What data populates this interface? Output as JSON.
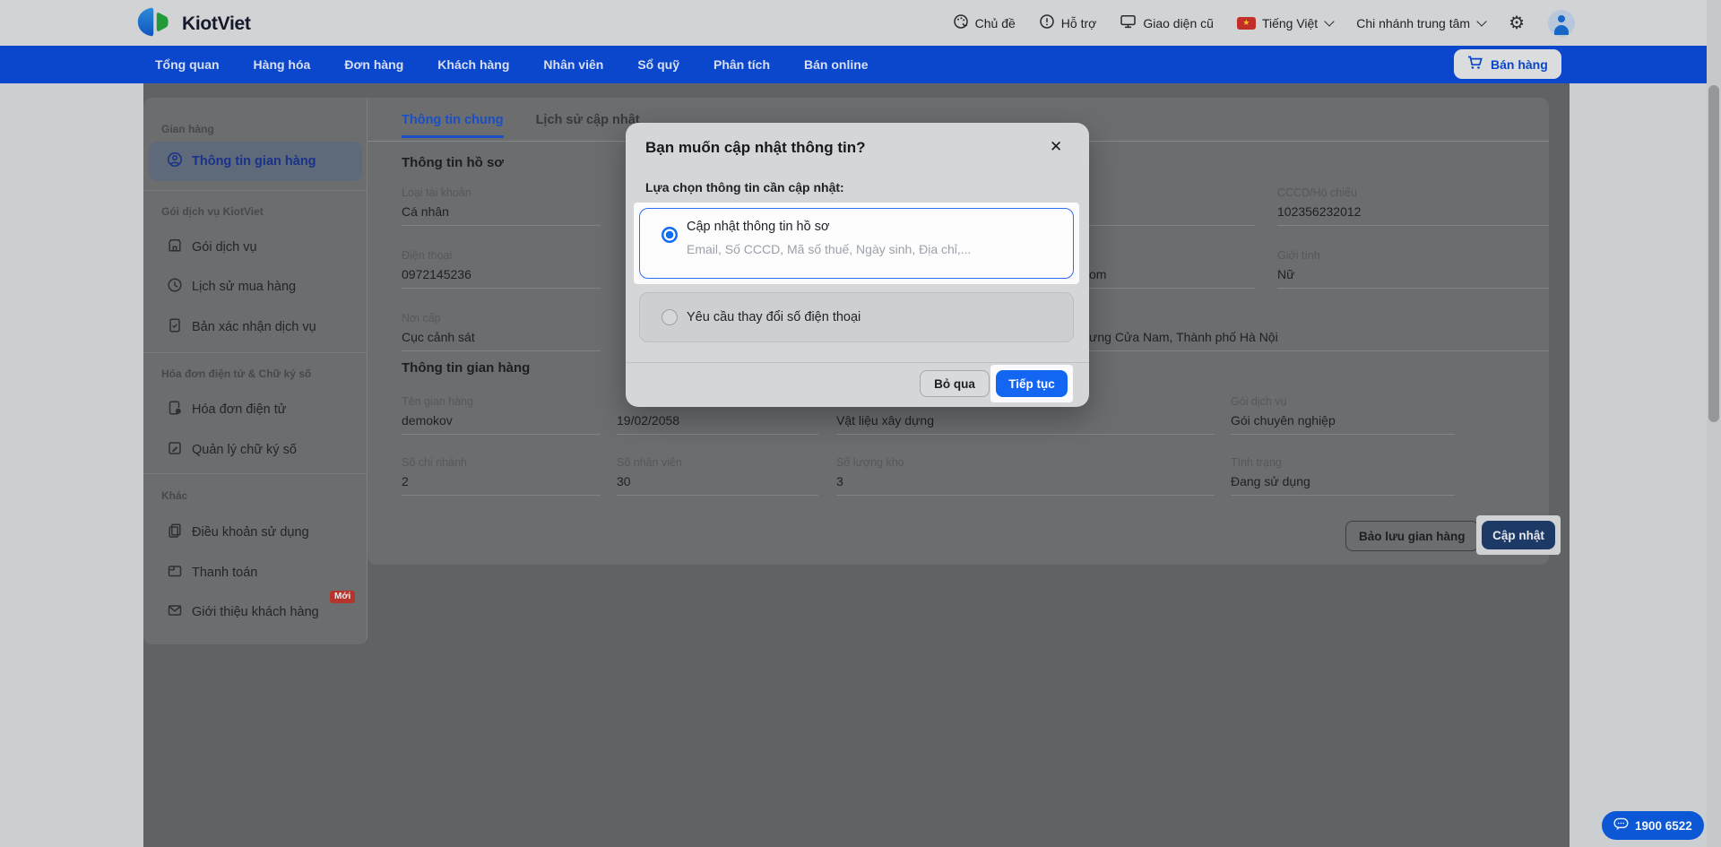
{
  "header": {
    "brand": "KiotViet",
    "menu": [
      {
        "icon": "palette-icon",
        "label": "Chủ đề"
      },
      {
        "icon": "help-icon",
        "label": "Hỗ trợ"
      },
      {
        "icon": "monitor-icon",
        "label": "Giao diện cũ"
      }
    ],
    "language": {
      "icon": "vietnam-flag-icon",
      "star": "★",
      "label": "Tiếng Việt"
    },
    "branch": {
      "label": "Chi nhánh trung tâm"
    },
    "gear": "⚙"
  },
  "nav": {
    "items": [
      "Tổng quan",
      "Hàng hóa",
      "Đơn hàng",
      "Khách hàng",
      "Nhân viên",
      "Sổ quỹ",
      "Phân tích",
      "Bán online"
    ],
    "sell_button": "Bán hàng"
  },
  "sidebar": {
    "sections": [
      {
        "title": "Gian hàng",
        "items": [
          {
            "icon": "user-circle-icon",
            "label": "Thông tin gian hàng",
            "active": true
          }
        ]
      },
      {
        "title": "Gói dịch vụ KiotViet",
        "items": [
          {
            "icon": "store-icon",
            "label": "Gói dịch vụ"
          },
          {
            "icon": "history-icon",
            "label": "Lịch sử mua hàng"
          },
          {
            "icon": "document-check-icon",
            "label": "Bản xác nhận dịch vụ"
          }
        ]
      },
      {
        "title": "Hóa đơn điện tử & Chữ ký số",
        "items": [
          {
            "icon": "invoice-icon",
            "label": "Hóa đơn điện tử"
          },
          {
            "icon": "signature-icon",
            "label": "Quản lý chữ ký số"
          }
        ]
      },
      {
        "title": "Khác",
        "items": [
          {
            "icon": "terms-icon",
            "label": "Điều khoản sử dụng"
          },
          {
            "icon": "wallet-icon",
            "label": "Thanh toán"
          },
          {
            "icon": "mail-icon",
            "label": "Giới thiệu khách hàng",
            "badge": "Mới"
          }
        ]
      }
    ]
  },
  "main": {
    "tabs": [
      {
        "label": "Thông tin chung",
        "active": true
      },
      {
        "label": "Lịch sử cập nhật",
        "active": false
      }
    ],
    "profile": {
      "title": "Thông tin hồ sơ",
      "fields": [
        {
          "label": "Loại tài khoản",
          "value": "Cá nhân"
        },
        {
          "label": "CCCD/Hộ chiếu",
          "value": "102356232012"
        },
        {
          "label": "Điện thoại",
          "value": "0972145236"
        },
        {
          "label": "",
          "value": "om"
        },
        {
          "label": "Giới tính",
          "value": "Nữ"
        },
        {
          "label": "Nơi cấp",
          "value": "Cục cảnh sát"
        },
        {
          "label": "",
          "value": "ưng Cửa Nam, Thành phố Hà Nội"
        },
        {
          "label": "",
          "value": ""
        }
      ]
    },
    "store": {
      "title": "Thông tin gian hàng",
      "fields": [
        {
          "label": "Tên gian hàng",
          "value": "demokov"
        },
        {
          "label": "",
          "value": "19/02/2058"
        },
        {
          "label": "",
          "value": "Vật liệu xây dựng"
        },
        {
          "label": "Gói dịch vụ",
          "value": "Gói chuyên nghiệp"
        },
        {
          "label": "Số chi nhánh",
          "value": "2"
        },
        {
          "label": "Số nhân viên",
          "value": "30"
        },
        {
          "label": "Số lượng kho",
          "value": "3"
        },
        {
          "label": "Tình trạng",
          "value": "Đang sử dụng"
        }
      ]
    },
    "actions": {
      "reserve": "Bảo lưu gian hàng",
      "update": "Cập nhật"
    }
  },
  "modal": {
    "title": "Bạn muốn cập nhật thông tin?",
    "close": "✕",
    "prompt": "Lựa chọn thông tin cần cập nhật:",
    "options": [
      {
        "title": "Cập nhật thông tin hồ sơ",
        "subtitle": "Email, Số CCCD, Mã số thuế, Ngày sinh, Địa chỉ,...",
        "selected": true
      },
      {
        "title": "Yêu cầu thay đổi số điện thoại",
        "selected": false
      }
    ],
    "skip": "Bỏ qua",
    "continue": "Tiếp tục"
  },
  "support": {
    "phone": "1900 6522"
  },
  "colors": {
    "nav_blue": "#0a47cd",
    "primary_blue": "#1266f1",
    "active_blue": "#1b4fc4",
    "dark_navy_button": "#1d3a66",
    "badge_red": "#b5342c",
    "brand_green": "#239a38"
  }
}
